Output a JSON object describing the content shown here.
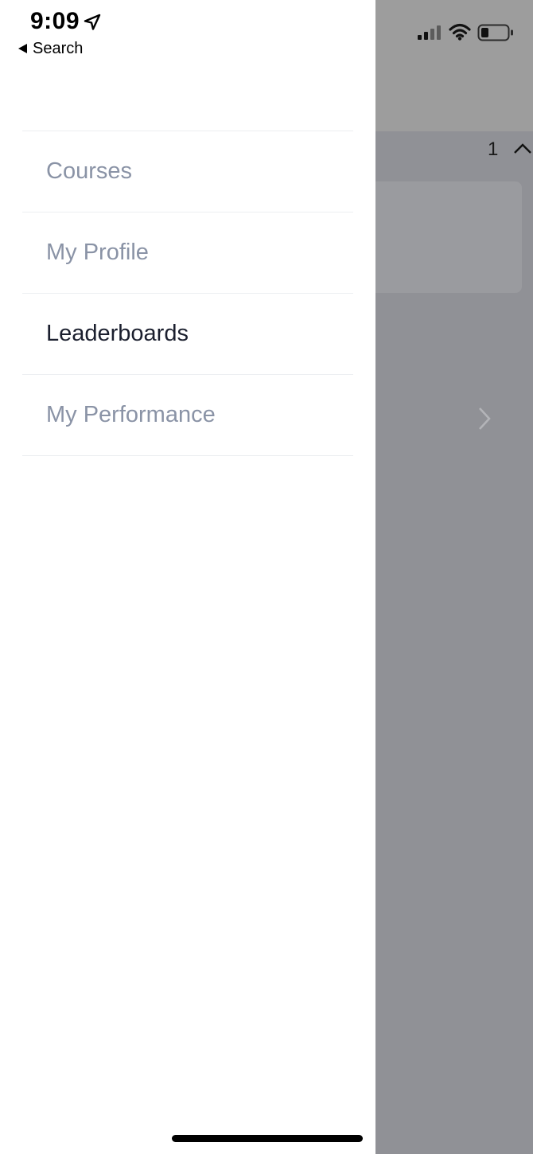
{
  "status_bar": {
    "time": "9:09",
    "back_label": "Search"
  },
  "background": {
    "count": "1"
  },
  "menu": {
    "items": [
      {
        "label": "Courses",
        "active": false
      },
      {
        "label": "My Profile",
        "active": false
      },
      {
        "label": "Leaderboards",
        "active": true
      },
      {
        "label": "My Performance",
        "active": false
      }
    ]
  },
  "colors": {
    "active_text": "#1b1f2e",
    "inactive_text": "#8a93a6",
    "overlay": "#909196"
  }
}
